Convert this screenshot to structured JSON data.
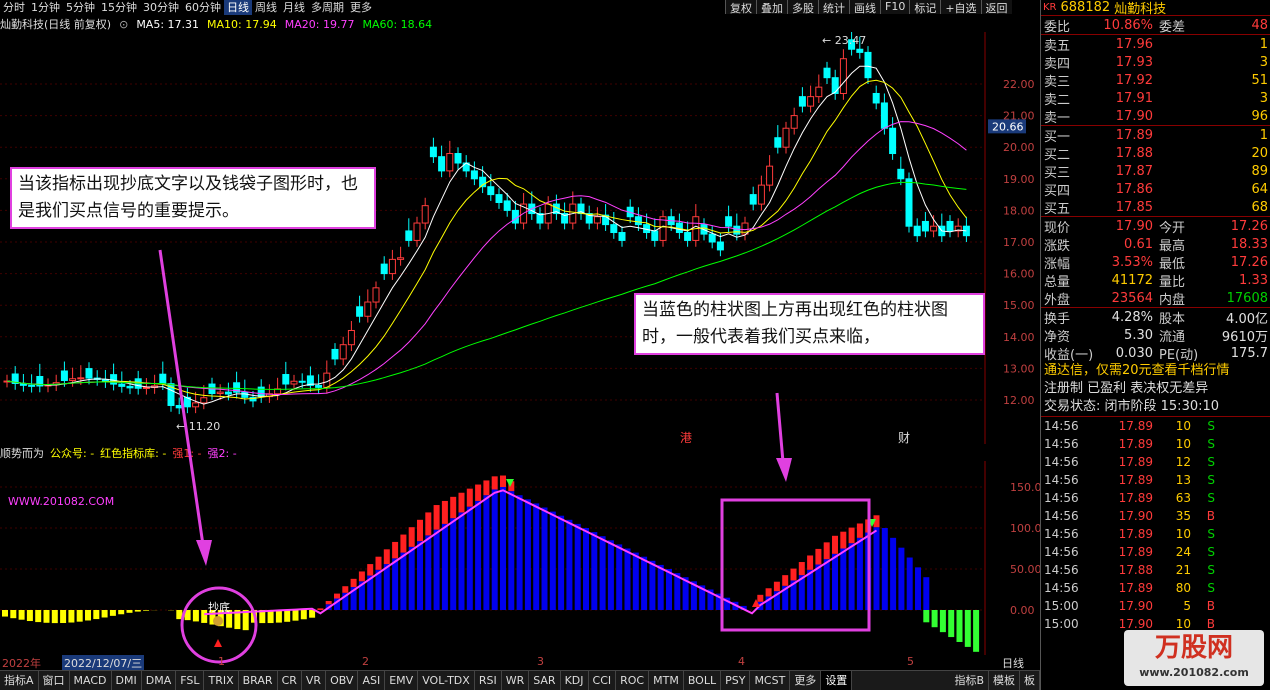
{
  "periods": [
    "分时",
    "1分钟",
    "5分钟",
    "15分钟",
    "30分钟",
    "60分钟",
    "日线",
    "周线",
    "月线",
    "多周期",
    "更多"
  ],
  "active_period": "日线",
  "toolbar": [
    "复权",
    "叠加",
    "多股",
    "统计",
    "画线",
    "F10",
    "标记",
    "+自选",
    "返回"
  ],
  "chart": {
    "stock_title": "灿勤科技(日线 前复权)",
    "ma": [
      {
        "label": "MA5: 17.31",
        "color": "#ffffff"
      },
      {
        "label": "MA10: 17.94",
        "color": "#ffff00"
      },
      {
        "label": "MA20: 19.77",
        "color": "#ff40ff"
      },
      {
        "label": "MA60: 18.64",
        "color": "#00ff00"
      }
    ],
    "price_axis": [
      "22.00",
      "21.00",
      "20.00",
      "19.00",
      "18.00",
      "17.00",
      "16.00",
      "15.00",
      "14.00",
      "13.00",
      "12.00"
    ],
    "current_price_tag": "20.66",
    "high_label": "23.47",
    "low_label": "11.20",
    "event_markers": [
      "港",
      "财"
    ]
  },
  "indicator": {
    "name": "顺势而为",
    "gzh": "公众号: -",
    "lib": "红色指标库: -",
    "s1": "强1: -",
    "s2": "强2: -",
    "url": "WWW.201082.COM",
    "axis": [
      "150.00",
      "100.00",
      "50.00",
      "0.00"
    ],
    "buy_label": "抄底"
  },
  "callouts": {
    "left": "当该指标出现抄底文字以及钱袋子图形时，也是我们买点信号的重要提示。",
    "right": "当蓝色的柱状图上方再出现红色的柱状图时，一般代表着我们买点来临，"
  },
  "dates": {
    "year": "2022年",
    "start": "2022/12/07/三",
    "months": [
      "1",
      "2",
      "3",
      "4",
      "5"
    ],
    "period_label": "日线"
  },
  "tabs": [
    "指标A",
    "窗口",
    "MACD",
    "DMI",
    "DMA",
    "FSL",
    "TRIX",
    "BRAR",
    "CR",
    "VR",
    "OBV",
    "ASI",
    "EMV",
    "VOL-TDX",
    "RSI",
    "WR",
    "SAR",
    "KDJ",
    "CCI",
    "ROC",
    "MTM",
    "BOLL",
    "PSY",
    "MCST",
    "更多",
    "设置"
  ],
  "tabs_right": [
    "指标B",
    "模板",
    "板"
  ],
  "side": {
    "kr": "KR",
    "code": "688182",
    "name": "灿勤科技",
    "wb": {
      "l": "委比",
      "v": "10.86%",
      "l2": "委差",
      "v2": "48"
    },
    "asks": [
      {
        "l": "卖五",
        "p": "17.96",
        "q": "1"
      },
      {
        "l": "卖四",
        "p": "17.93",
        "q": "3"
      },
      {
        "l": "卖三",
        "p": "17.92",
        "q": "51"
      },
      {
        "l": "卖二",
        "p": "17.91",
        "q": "3"
      },
      {
        "l": "卖一",
        "p": "17.90",
        "q": "96"
      }
    ],
    "bids": [
      {
        "l": "买一",
        "p": "17.89",
        "q": "1"
      },
      {
        "l": "买二",
        "p": "17.88",
        "q": "20"
      },
      {
        "l": "买三",
        "p": "17.87",
        "q": "89"
      },
      {
        "l": "买四",
        "p": "17.86",
        "q": "64"
      },
      {
        "l": "买五",
        "p": "17.85",
        "q": "68"
      }
    ],
    "stats": [
      {
        "l": "现价",
        "v": "17.90",
        "vc": "r",
        "l2": "今开",
        "v2": "17.26",
        "v2c": "r"
      },
      {
        "l": "涨跌",
        "v": "0.61",
        "vc": "r",
        "l2": "最高",
        "v2": "18.33",
        "v2c": "r"
      },
      {
        "l": "涨幅",
        "v": "3.53%",
        "vc": "r",
        "l2": "最低",
        "v2": "17.26",
        "v2c": "r"
      },
      {
        "l": "总量",
        "v": "41172",
        "vc": "y",
        "l2": "量比",
        "v2": "1.33",
        "v2c": "r"
      },
      {
        "l": "外盘",
        "v": "23564",
        "vc": "r",
        "l2": "内盘",
        "v2": "17608",
        "v2c": "g"
      }
    ],
    "stats2": [
      {
        "l": "换手",
        "v": "4.28%",
        "vc": "w",
        "l2": "股本",
        "v2": "4.00亿",
        "v2c": "w"
      },
      {
        "l": "净资",
        "v": "5.30",
        "vc": "w",
        "l2": "流通",
        "v2": "9610万",
        "v2c": "w"
      },
      {
        "l": "收益(一)",
        "v": "0.030",
        "vc": "w",
        "l2": "PE(动)",
        "v2": "175.7",
        "v2c": "w"
      }
    ],
    "ad": "通达信，仅需20元查看千档行情",
    "reg": "注册制 已盈利 表决权无差异",
    "status": "交易状态: 闭市阶段 15:30:10",
    "ticks": [
      {
        "t": "14:56",
        "p": "17.89",
        "q": "10",
        "s": "S"
      },
      {
        "t": "14:56",
        "p": "17.89",
        "q": "10",
        "s": "S"
      },
      {
        "t": "14:56",
        "p": "17.89",
        "q": "12",
        "s": "S"
      },
      {
        "t": "14:56",
        "p": "17.89",
        "q": "13",
        "s": "S"
      },
      {
        "t": "14:56",
        "p": "17.89",
        "q": "63",
        "s": "S"
      },
      {
        "t": "14:56",
        "p": "17.90",
        "q": "35",
        "s": "B"
      },
      {
        "t": "14:56",
        "p": "17.89",
        "q": "10",
        "s": "S"
      },
      {
        "t": "14:56",
        "p": "17.89",
        "q": "24",
        "s": "S"
      },
      {
        "t": "14:56",
        "p": "17.88",
        "q": "21",
        "s": "S"
      },
      {
        "t": "14:56",
        "p": "17.89",
        "q": "80",
        "s": "S"
      },
      {
        "t": "15:00",
        "p": "17.90",
        "q": "5",
        "s": "B"
      },
      {
        "t": "15:00",
        "p": "17.90",
        "q": "10",
        "s": "B"
      }
    ],
    "logo_brand": "万股网",
    "logo_url": "www.201082.com"
  }
}
